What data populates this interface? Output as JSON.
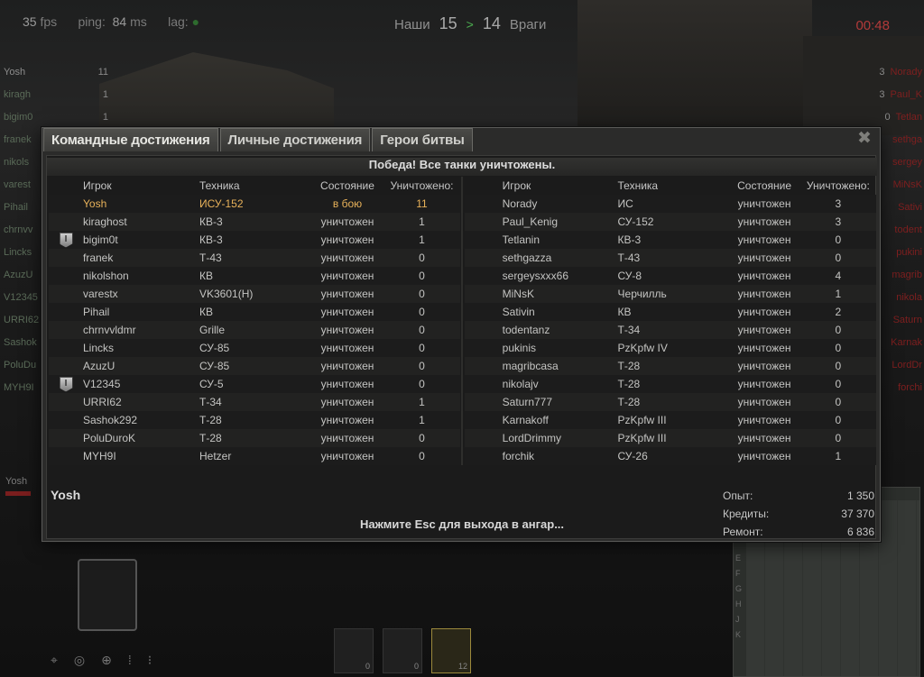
{
  "hud": {
    "fps_value": "35",
    "fps_unit": "fps",
    "ping_label": "ping:",
    "ping_value": "84",
    "ping_unit": "ms",
    "lag_label": "lag:",
    "allies_label": "Наши",
    "allies_score": "15",
    "enemies_score": "14",
    "enemies_label": "Враги",
    "timer": "00:48",
    "own_tag": "Yosh"
  },
  "roster_left": [
    {
      "name": "Yosh",
      "value": "11"
    },
    {
      "name": "kiragh",
      "value": "1"
    },
    {
      "name": "bigim0",
      "value": "1"
    },
    {
      "name": "franek",
      "value": ""
    },
    {
      "name": "nikols",
      "value": ""
    },
    {
      "name": "varest",
      "value": ""
    },
    {
      "name": "Pihail",
      "value": ""
    },
    {
      "name": "chrnvv",
      "value": ""
    },
    {
      "name": "Lincks",
      "value": ""
    },
    {
      "name": "AzuzU",
      "value": ""
    },
    {
      "name": "V12345",
      "value": ""
    },
    {
      "name": "URRI62",
      "value": ""
    },
    {
      "name": "Sashok",
      "value": ""
    },
    {
      "name": "PoluDu",
      "value": ""
    },
    {
      "name": "MYH9I",
      "value": ""
    }
  ],
  "roster_right": [
    {
      "name": "Norady",
      "value": "3"
    },
    {
      "name": "Paul_K",
      "value": "3"
    },
    {
      "name": "Tetlan",
      "value": "0"
    },
    {
      "name": "sethga",
      "value": ""
    },
    {
      "name": "sergey",
      "value": ""
    },
    {
      "name": "MiNsK",
      "value": ""
    },
    {
      "name": "Sativi",
      "value": ""
    },
    {
      "name": "todent",
      "value": ""
    },
    {
      "name": "pukini",
      "value": ""
    },
    {
      "name": "magrib",
      "value": ""
    },
    {
      "name": "nikola",
      "value": ""
    },
    {
      "name": "Saturn",
      "value": ""
    },
    {
      "name": "Karnak",
      "value": ""
    },
    {
      "name": "LordDr",
      "value": ""
    },
    {
      "name": "forchi",
      "value": ""
    }
  ],
  "minimap": {
    "coords": [
      "E",
      "F",
      "G",
      "H",
      "J",
      "K"
    ]
  },
  "ammo": [
    "0",
    "0",
    "12"
  ],
  "dialog": {
    "tabs": [
      "Командные достижения",
      "Личные достижения",
      "Герои битвы"
    ],
    "headline": "Победа! Все танки уничтожены.",
    "columns": {
      "player": "Игрок",
      "tank": "Техника",
      "status": "Состояние",
      "kills": "Уничтожено:"
    },
    "allies": [
      {
        "player": "Yosh",
        "tank": "ИСУ-152",
        "status": "в бою",
        "kills": "11",
        "badge": ""
      },
      {
        "player": "kiraghost",
        "tank": "КВ-3",
        "status": "уничтожен",
        "kills": "1",
        "badge": ""
      },
      {
        "player": "bigim0t",
        "tank": "КВ-3",
        "status": "уничтожен",
        "kills": "1",
        "badge": "I"
      },
      {
        "player": "franek",
        "tank": "Т-43",
        "status": "уничтожен",
        "kills": "0",
        "badge": ""
      },
      {
        "player": "nikolshon",
        "tank": "КВ",
        "status": "уничтожен",
        "kills": "0",
        "badge": ""
      },
      {
        "player": "varestx",
        "tank": "VK3601(H)",
        "status": "уничтожен",
        "kills": "0",
        "badge": ""
      },
      {
        "player": "Pihail",
        "tank": "КВ",
        "status": "уничтожен",
        "kills": "0",
        "badge": ""
      },
      {
        "player": "chrnvvldmr",
        "tank": "Grille",
        "status": "уничтожен",
        "kills": "0",
        "badge": ""
      },
      {
        "player": "Lincks",
        "tank": "СУ-85",
        "status": "уничтожен",
        "kills": "0",
        "badge": ""
      },
      {
        "player": "AzuzU",
        "tank": "СУ-85",
        "status": "уничтожен",
        "kills": "0",
        "badge": ""
      },
      {
        "player": "V12345",
        "tank": "СУ-5",
        "status": "уничтожен",
        "kills": "0",
        "badge": "I"
      },
      {
        "player": "URRI62",
        "tank": "Т-34",
        "status": "уничтожен",
        "kills": "1",
        "badge": ""
      },
      {
        "player": "Sashok292",
        "tank": "Т-28",
        "status": "уничтожен",
        "kills": "1",
        "badge": ""
      },
      {
        "player": "PoluDuroK",
        "tank": "Т-28",
        "status": "уничтожен",
        "kills": "0",
        "badge": ""
      },
      {
        "player": "MYH9I",
        "tank": "Hetzer",
        "status": "уничтожен",
        "kills": "0",
        "badge": ""
      }
    ],
    "enemies": [
      {
        "player": "Norady",
        "tank": "ИС",
        "status": "уничтожен",
        "kills": "3"
      },
      {
        "player": "Paul_Kenig",
        "tank": "СУ-152",
        "status": "уничтожен",
        "kills": "3"
      },
      {
        "player": "Tetlanin",
        "tank": "КВ-3",
        "status": "уничтожен",
        "kills": "0"
      },
      {
        "player": "sethgazza",
        "tank": "Т-43",
        "status": "уничтожен",
        "kills": "0"
      },
      {
        "player": "sergeysxxx66",
        "tank": "СУ-8",
        "status": "уничтожен",
        "kills": "4"
      },
      {
        "player": "MiNsK",
        "tank": "Черчилль",
        "status": "уничтожен",
        "kills": "1"
      },
      {
        "player": "Sativin",
        "tank": "КВ",
        "status": "уничтожен",
        "kills": "2"
      },
      {
        "player": "todentanz",
        "tank": "Т-34",
        "status": "уничтожен",
        "kills": "0"
      },
      {
        "player": "pukinis",
        "tank": "PzKpfw IV",
        "status": "уничтожен",
        "kills": "0"
      },
      {
        "player": "magribcasa",
        "tank": "Т-28",
        "status": "уничтожен",
        "kills": "0"
      },
      {
        "player": "nikolajv",
        "tank": "Т-28",
        "status": "уничтожен",
        "kills": "0"
      },
      {
        "player": "Saturn777",
        "tank": "Т-28",
        "status": "уничтожен",
        "kills": "0"
      },
      {
        "player": "Karnakoff",
        "tank": "PzKpfw III",
        "status": "уничтожен",
        "kills": "0"
      },
      {
        "player": "LordDrimmy",
        "tank": "PzKpfw III",
        "status": "уничтожен",
        "kills": "0"
      },
      {
        "player": "forchik",
        "tank": "СУ-26",
        "status": "уничтожен",
        "kills": "1"
      }
    ],
    "player_name": "Yosh",
    "stats": [
      {
        "label": "Опыт:",
        "value": "1 350"
      },
      {
        "label": "Кредиты:",
        "value": "37 370"
      },
      {
        "label": "Ремонт:",
        "value": "6 836"
      }
    ],
    "esc_hint": "Нажмите Esc для выхода в ангар..."
  }
}
